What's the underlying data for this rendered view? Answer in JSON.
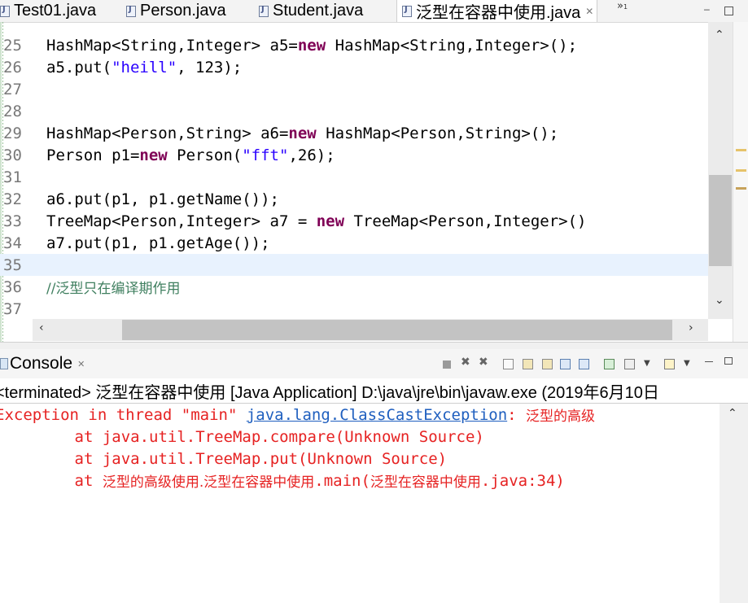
{
  "tabs": [
    {
      "label": "Test01.java"
    },
    {
      "label": "Person.java"
    },
    {
      "label": "Student.java"
    },
    {
      "label": "泛型在容器中使用.java",
      "close": "✕"
    }
  ],
  "tab_overflow": {
    "symbol": "»",
    "count": "1"
  },
  "editor": {
    "lines": [
      {
        "num": "25"
      },
      {
        "num": "26"
      },
      {
        "num": "27"
      },
      {
        "num": "28"
      },
      {
        "num": "29"
      },
      {
        "num": "30"
      },
      {
        "num": "31"
      },
      {
        "num": "32"
      },
      {
        "num": "33"
      },
      {
        "num": "34"
      },
      {
        "num": "35"
      },
      {
        "num": "36"
      },
      {
        "num": "37"
      }
    ],
    "code": {
      "l25a": "HashMap<String,Integer> a5=",
      "l25kw": "new",
      "l25b": " HashMap<String,Integer>();",
      "l26a": "a5.put(",
      "l26str": "\"heill\"",
      "l26b": ", 123);",
      "l29a": "HashMap<Person,String> a6=",
      "l29kw": "new",
      "l29b": " HashMap<Person,String>();",
      "l30a": "Person p1=",
      "l30kw": "new",
      "l30b": " Person(",
      "l30str": "\"fft\"",
      "l30c": ",26);",
      "l32": "a6.put(p1, p1.getName());",
      "l33a": "TreeMap<Person,Integer> a7 = ",
      "l33kw": "new",
      "l33b": " TreeMap<Person,Integer>()",
      "l34": "a7.put(p1, p1.getAge());",
      "l36": "//泛型只在编译期作用"
    }
  },
  "console": {
    "tab_label": "Console",
    "tab_close": "✕",
    "status_line": "<terminated> 泛型在容器中使用 [Java Application] D:\\java\\jre\\bin\\javaw.exe (2019年6月10日",
    "exception_prefix": "Exception in thread \"main\" ",
    "exception_class": "java.lang.ClassCastException",
    "exception_suffix": ": ",
    "exception_msg": "泛型的高级",
    "trace1": "        at java.util.TreeMap.compare(Unknown Source)",
    "trace2": "        at java.util.TreeMap.put(Unknown Source)",
    "trace3_prefix": "        at ",
    "trace3_pkg": "泛型的高级使用.泛型在容器中使用",
    "trace3_mid": ".main(",
    "trace3_file": "泛型在容器中使用",
    "trace3_end": ".java:34)"
  },
  "colors": {
    "keyword": "#7f0055",
    "string": "#2a00ff",
    "comment": "#3f7f5f",
    "error": "#e62222",
    "link": "#1f5fbf",
    "current_line": "#e8f2fe"
  }
}
